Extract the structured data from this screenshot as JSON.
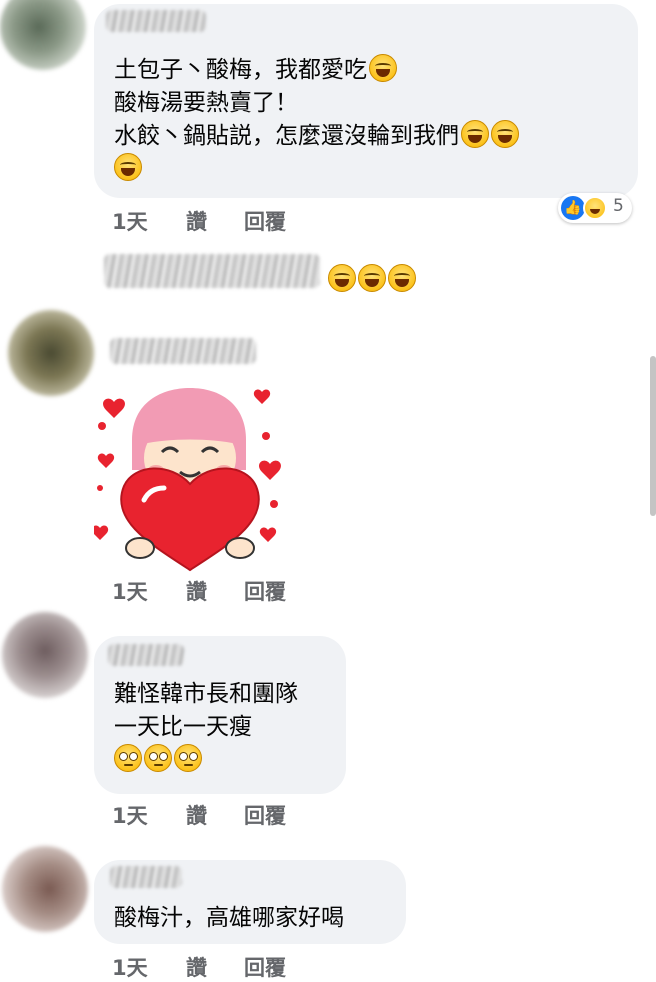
{
  "comments": [
    {
      "lines": [
        "土包子丶酸梅，我都愛吃",
        "酸梅湯要熱賣了！",
        "水餃丶鍋貼説，怎麼還沒輪到我們"
      ],
      "time": "1天",
      "like": "讚",
      "reply": "回覆",
      "reaction_count": "5"
    },
    {
      "time": "1天",
      "like": "讚",
      "reply": "回覆"
    },
    {
      "lines": [
        "難怪韓市長和團隊",
        "一天比一天瘦"
      ],
      "time": "1天",
      "like": "讚",
      "reply": "回覆"
    },
    {
      "lines": [
        "酸梅汁，高雄哪家好喝"
      ],
      "time": "1天",
      "like": "讚",
      "reply": "回覆"
    }
  ],
  "icons": {
    "laugh_emoji": "face-with-tears-of-joy-icon",
    "eyeroll_emoji": "face-with-rolling-eyes-icon",
    "like_reaction": "like-icon",
    "haha_reaction": "haha-icon",
    "sticker": "girl-holding-heart-sticker"
  },
  "colors": {
    "bubble": "#f0f2f5",
    "meta_text": "#65676b",
    "like_blue": "#1877f2"
  }
}
